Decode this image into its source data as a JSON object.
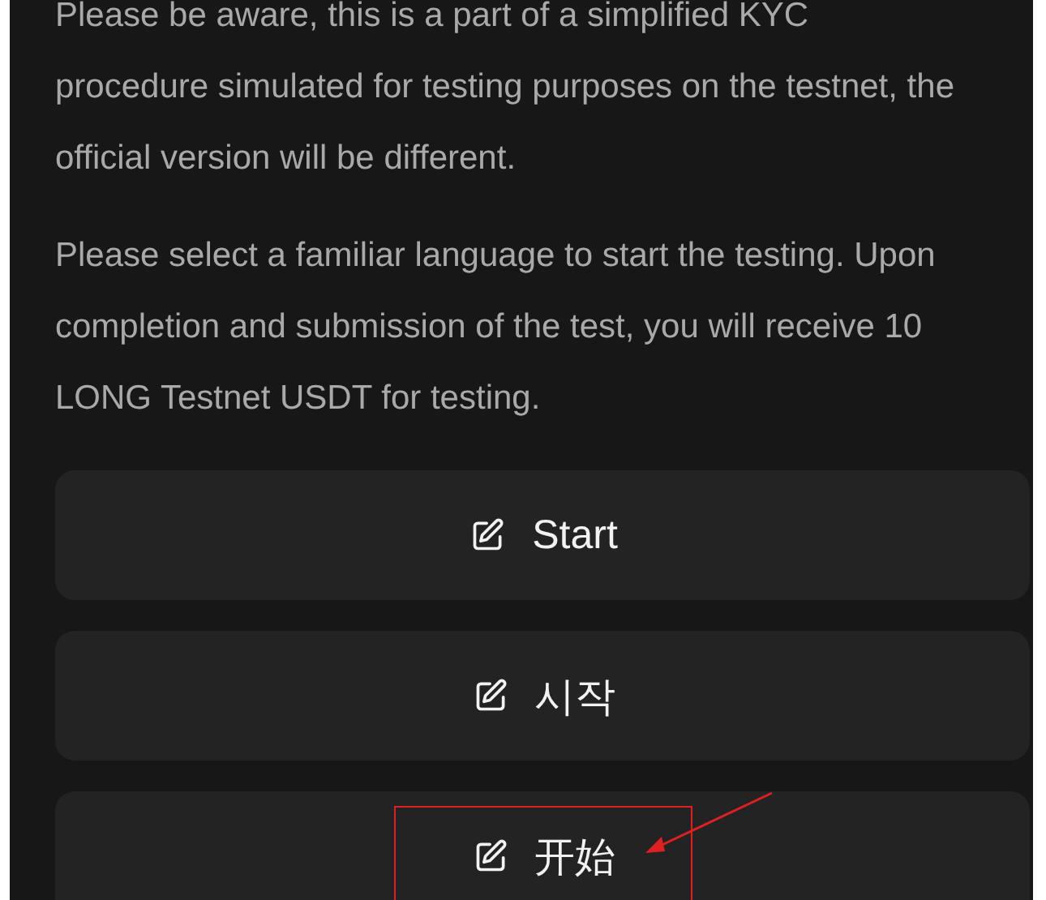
{
  "notice_paragraphs": [
    "Please be aware, this is a part of a simplified KYC procedure simulated for testing purposes on the testnet, the official version will be different.",
    "Please select a familiar language to start the testing. Upon completion and submission of the test, you will receive 10 LONG Testnet USDT for testing."
  ],
  "buttons": [
    {
      "label": "Start",
      "highlighted": false
    },
    {
      "label": "시작",
      "highlighted": false
    },
    {
      "label": "开始",
      "highlighted": true
    }
  ]
}
